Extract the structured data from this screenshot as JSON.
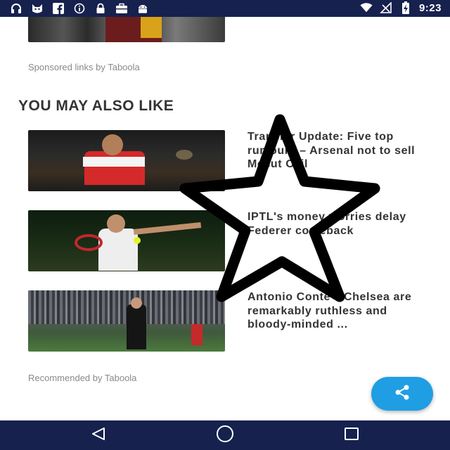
{
  "status_bar": {
    "time": "9:23",
    "left_icons": [
      "headset-icon",
      "cat-app-icon",
      "facebook-icon",
      "info-icon",
      "lock-icon",
      "briefcase-icon",
      "android-icon"
    ],
    "right_icons": [
      "wifi-icon",
      "no-signal-icon",
      "battery-charging-icon"
    ]
  },
  "feed": {
    "sponsored_label": "Sponsored links by Taboola",
    "section_title": "YOU MAY ALSO LIKE",
    "articles": [
      {
        "title": "Transfer Update: Five top rumours – Arsenal not to sell Mesut Ozil"
      },
      {
        "title": "IPTL's money worries delay Federer comeback"
      },
      {
        "title": "Antonio Conte's Chelsea are remarkably ruthless and bloody-minded ..."
      }
    ],
    "recommended_label": "Recommended by Taboola"
  },
  "fab": {
    "icon": "share-icon"
  },
  "nav_bar": {
    "icons": [
      "back-icon",
      "home-icon",
      "recents-icon"
    ]
  },
  "colors": {
    "system_bar": "#16214e",
    "fab": "#1f9ee4",
    "text": "#333333",
    "muted": "#8a8a8a"
  }
}
